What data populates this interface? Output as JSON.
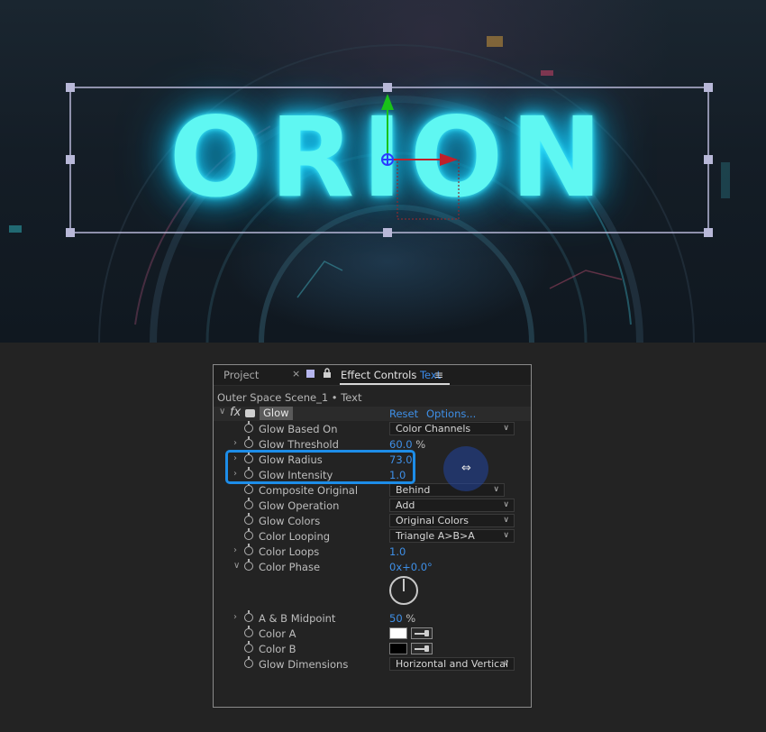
{
  "viewer": {
    "title_text": "ORION",
    "colors": {
      "glow": "#5ff7f2",
      "bounding_box": "#b8b8d8",
      "y_axis": "#19c219",
      "x_axis": "#c0202a",
      "anchor": "#2a3cff"
    }
  },
  "panel": {
    "tab_project": "Project",
    "tab_close_icon": "close-icon",
    "tab_effect_controls": "Effect Controls",
    "tab_layer_name": "Text",
    "tab_menu_icon": "hamburger-menu-icon",
    "comp_path": "Outer Space Scene_1 • Text",
    "effect": {
      "name": "Glow",
      "reset": "Reset",
      "options": "Options..."
    },
    "properties": [
      {
        "label": "Glow Based On",
        "kind": "dropdown",
        "value": "Color Channels"
      },
      {
        "label": "Glow Threshold",
        "kind": "number",
        "value": "60.0",
        "unit": "%",
        "expandable": true
      },
      {
        "label": "Glow Radius",
        "kind": "number",
        "value": "73.0",
        "expandable": true
      },
      {
        "label": "Glow Intensity",
        "kind": "number",
        "value": "1.0",
        "expandable": true
      },
      {
        "label": "Composite Original",
        "kind": "dropdown",
        "value": "Behind"
      },
      {
        "label": "Glow Operation",
        "kind": "dropdown",
        "value": "Add"
      },
      {
        "label": "Glow Colors",
        "kind": "dropdown",
        "value": "Original Colors"
      },
      {
        "label": "Color Looping",
        "kind": "dropdown",
        "value": "Triangle A>B>A"
      },
      {
        "label": "Color Loops",
        "kind": "number",
        "value": "1.0",
        "expandable": true
      },
      {
        "label": "Color Phase",
        "kind": "angle",
        "value": "0x+0.0°",
        "expanded": true
      },
      {
        "label": "A & B Midpoint",
        "kind": "number",
        "value": "50",
        "unit": "%",
        "expandable": true
      },
      {
        "label": "Color A",
        "kind": "color",
        "value": "#ffffff"
      },
      {
        "label": "Color B",
        "kind": "color",
        "value": "#000000"
      },
      {
        "label": "Glow Dimensions",
        "kind": "dropdown",
        "value": "Horizontal and Vertical"
      }
    ],
    "highlight_color": "#1d8de8",
    "cursor_icon": "scrub-cursor-icon"
  }
}
